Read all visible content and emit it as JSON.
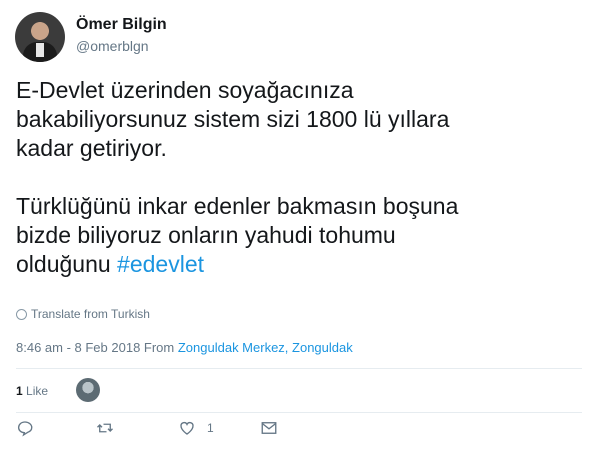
{
  "user": {
    "name": "Ömer Bilgin",
    "handle": "@omerblgn"
  },
  "tweet": {
    "text_main": "E-Devlet üzerinden soyağacınıza\nbakabiliyorsunuz sistem sizi 1800 lü yıllara\nkadar getiriyor.\n\nTürklüğünü inkar edenler bakmasın boşuna\nbizde biliyoruz onların yahudi tohumu\nolduğunu ",
    "hashtag": "#edevlet",
    "translate_label": "Translate from Turkish",
    "time": "8:46 am - 8 Feb 2018 From ",
    "location": "Zonguldak Merkez, Zonguldak"
  },
  "stats": {
    "like_count": "1",
    "like_label": " Like"
  },
  "actions": {
    "like_count": "1"
  },
  "colors": {
    "link": "#1b95e0",
    "secondary": "#657786",
    "text": "#14171a"
  },
  "icons": [
    "reply-icon",
    "retweet-icon",
    "heart-icon",
    "envelope-icon",
    "globe-icon"
  ]
}
